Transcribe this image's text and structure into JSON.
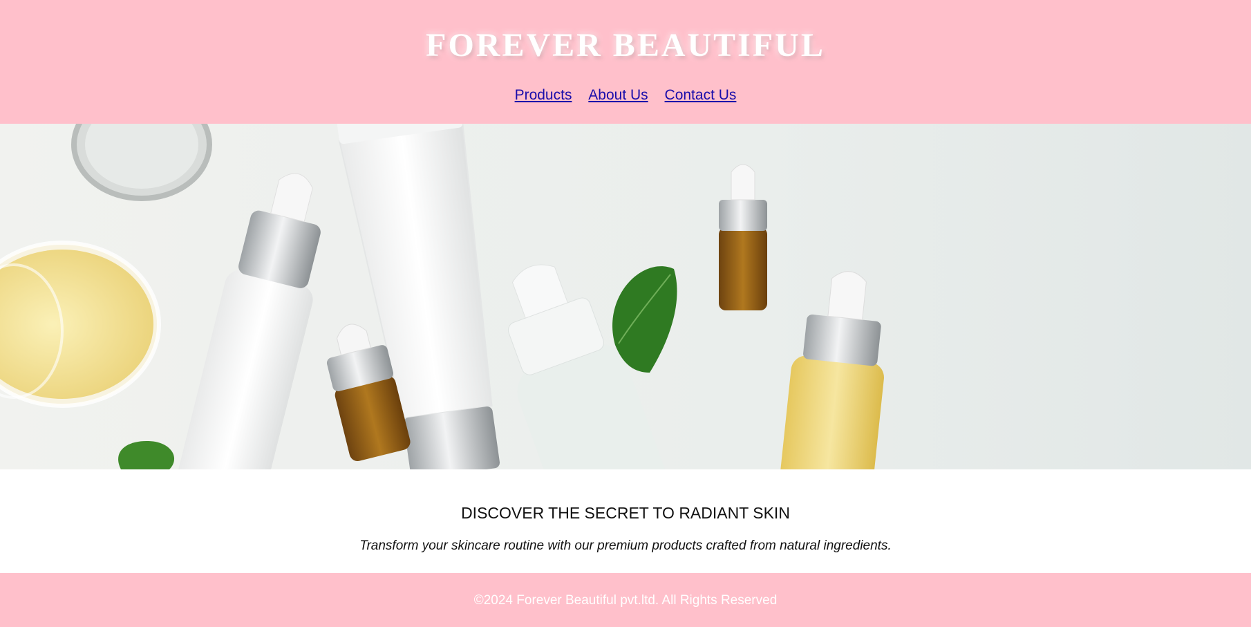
{
  "header": {
    "brand": "FOREVER BEAUTIFUL",
    "nav": [
      "Products",
      "About Us",
      "Contact Us"
    ],
    "background_color": "#ffc0cb"
  },
  "hero": {
    "image": "skincare-products-flatlay"
  },
  "main": {
    "tagline": "DISCOVER THE SECRET TO RADIANT SKIN",
    "subtext": "Transform your skincare routine with our premium products crafted from natural ingredients."
  },
  "footer": {
    "copyright": "©2024 Forever Beautiful pvt.ltd. All Rights Reserved",
    "background_color": "#ffc0cb"
  }
}
